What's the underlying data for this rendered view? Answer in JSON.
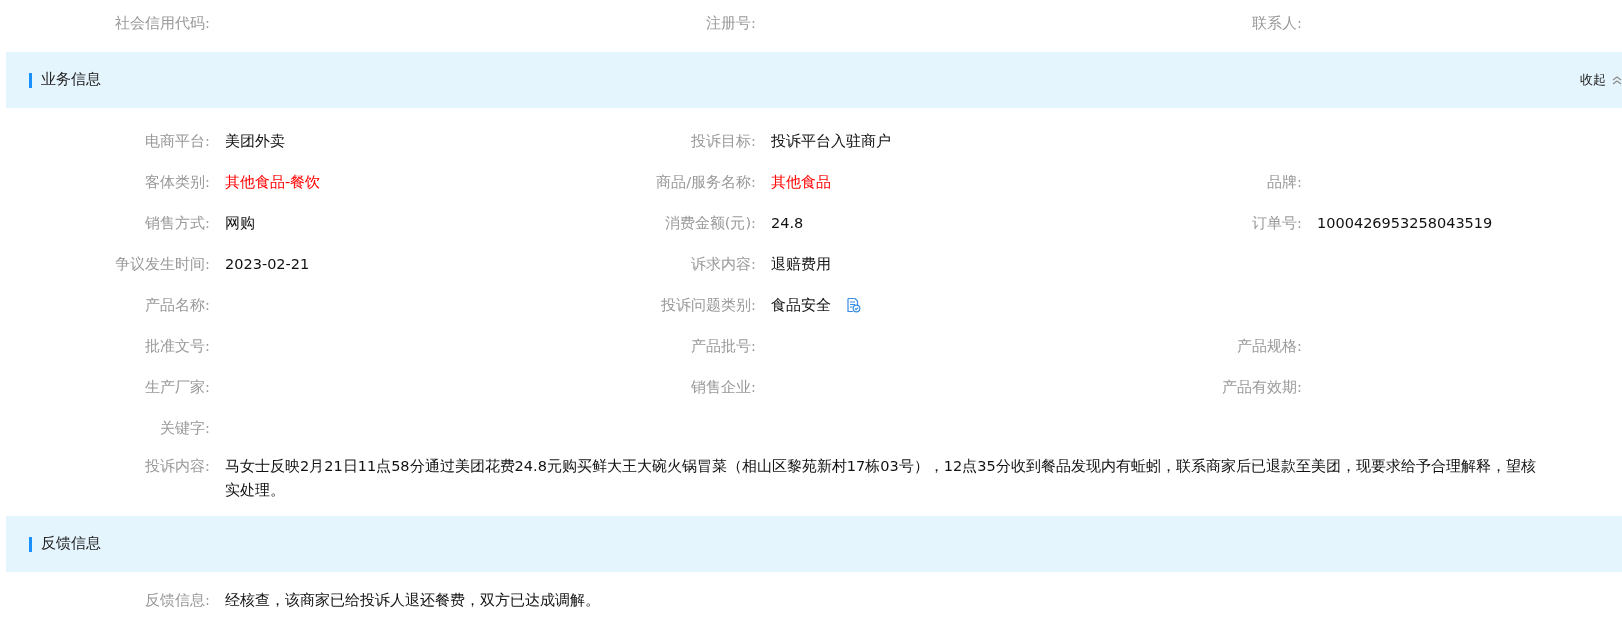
{
  "top_rows": [
    [
      {
        "label": "社会信用代码:"
      },
      {
        "label": "注册号:"
      },
      {
        "label": "联系人:"
      }
    ]
  ],
  "sections": [
    {
      "title": "业务信息",
      "collapse_label": "收起",
      "rows": [
        [
          {
            "label": "电商平台:",
            "value": "美团外卖",
            "emphasis": false
          },
          {
            "label": "投诉目标:",
            "value": "投诉平台入驻商户",
            "emphasis": false
          }
        ],
        [
          {
            "label": "客体类别:",
            "value": "其他食品-餐饮",
            "emphasis": true
          },
          {
            "label": "商品/服务名称:",
            "value": "其他食品",
            "emphasis": true
          },
          {
            "label": "品牌:"
          }
        ],
        [
          {
            "label": "销售方式:",
            "value": "网购",
            "emphasis": false
          },
          {
            "label": "消费金额(元):",
            "value": "24.8",
            "emphasis": false
          },
          {
            "label": "订单号:",
            "value": "1000426953258043519",
            "emphasis": false
          }
        ],
        [
          {
            "label": "争议发生时间:",
            "value": "2023-02-21",
            "emphasis": false
          },
          {
            "label": "诉求内容:",
            "value": "退赔费用",
            "emphasis": false
          }
        ],
        [
          {
            "label": "产品名称:"
          },
          {
            "label": "投诉问题类别:",
            "value": "食品安全",
            "emphasis": false,
            "has_icon": true
          }
        ],
        [
          {
            "label": "批准文号:"
          },
          {
            "label": "产品批号:"
          },
          {
            "label": "产品规格:"
          }
        ],
        [
          {
            "label": "生产厂家:"
          },
          {
            "label": "销售企业:"
          },
          {
            "label": "产品有效期:"
          }
        ],
        [
          {
            "label": "关键字:"
          }
        ],
        [
          {
            "label": "投诉内容:",
            "value": "马女士反映2月21日11点58分通过美团花费24.8元购买鲜大王大碗火锅冒菜（相山区黎苑新村17栋03号），12点35分收到餐品发现内有蚯蚓，联系商家后已退款至美团，现要求给予合理解释，望核实处理。",
            "emphasis": false,
            "kind": "wide"
          }
        ]
      ]
    },
    {
      "title": "反馈信息",
      "rows": [
        [
          {
            "label": "反馈信息:",
            "value": "经核查，该商家已给投诉人退还餐费，双方已达成调解。",
            "emphasis": false,
            "kind": "wide"
          }
        ]
      ]
    }
  ]
}
